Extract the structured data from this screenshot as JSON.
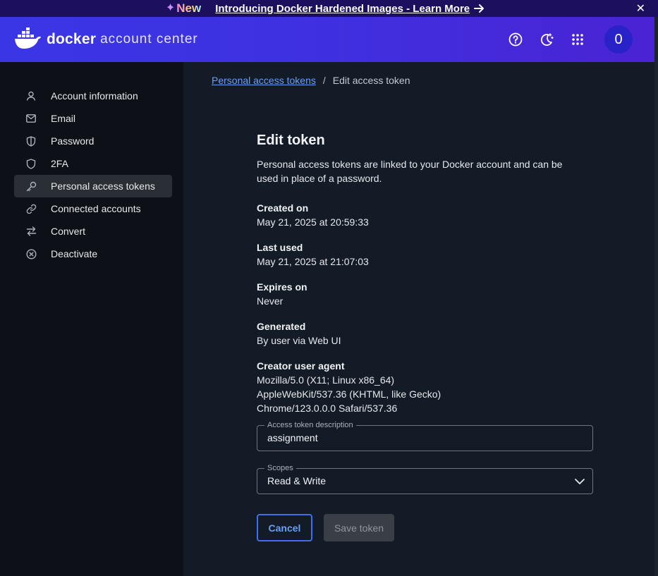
{
  "banner": {
    "new_label": "New",
    "link_text": "Introducing Docker Hardened Images - Learn More",
    "close_label": "✕"
  },
  "header": {
    "brand": "docker",
    "subtitle": "account center",
    "avatar_initial": "0",
    "icons": [
      "help-icon",
      "theme-toggle-icon",
      "apps-grid-icon"
    ]
  },
  "sidebar": {
    "items": [
      {
        "label": "Account information",
        "icon": "user-icon"
      },
      {
        "label": "Email",
        "icon": "mail-icon"
      },
      {
        "label": "Password",
        "icon": "shield-half-icon"
      },
      {
        "label": "2FA",
        "icon": "shield-icon"
      },
      {
        "label": "Personal access tokens",
        "icon": "key-icon",
        "active": true
      },
      {
        "label": "Connected accounts",
        "icon": "link-icon"
      },
      {
        "label": "Convert",
        "icon": "convert-arrows-icon"
      },
      {
        "label": "Deactivate",
        "icon": "x-circle-icon"
      }
    ]
  },
  "breadcrumb": {
    "parent": "Personal access tokens",
    "separator": "/",
    "current": "Edit access token"
  },
  "page": {
    "title": "Edit token",
    "description": "Personal access tokens are linked to your Docker account and can be used in place of a password."
  },
  "details": {
    "created_on": {
      "label": "Created on",
      "value": "May 21, 2025 at 20:59:33"
    },
    "last_used": {
      "label": "Last used",
      "value": "May 21, 2025 at 21:07:03"
    },
    "expires_on": {
      "label": "Expires on",
      "value": "Never"
    },
    "generated": {
      "label": "Generated",
      "value": "By user via Web UI"
    },
    "creator_agent": {
      "label": "Creator user agent",
      "line1": "Mozilla/5.0 (X11; Linux x86_64)",
      "line2": "AppleWebKit/537.36 (KHTML, like Gecko)",
      "line3": "Chrome/123.0.0.0 Safari/537.36"
    }
  },
  "form": {
    "description_field": {
      "label": "Access token description",
      "value": "assignment"
    },
    "scopes_field": {
      "label": "Scopes",
      "value": "Read & Write"
    }
  },
  "actions": {
    "cancel": "Cancel",
    "save": "Save token"
  },
  "colors": {
    "header_gradient_start": "#3a36e6",
    "header_gradient_end": "#4a23d4",
    "banner_bg": "#1b0f5e",
    "accent_link": "#6b9ff5",
    "sidebar_bg": "#0d1117",
    "main_bg": "#131b26"
  }
}
